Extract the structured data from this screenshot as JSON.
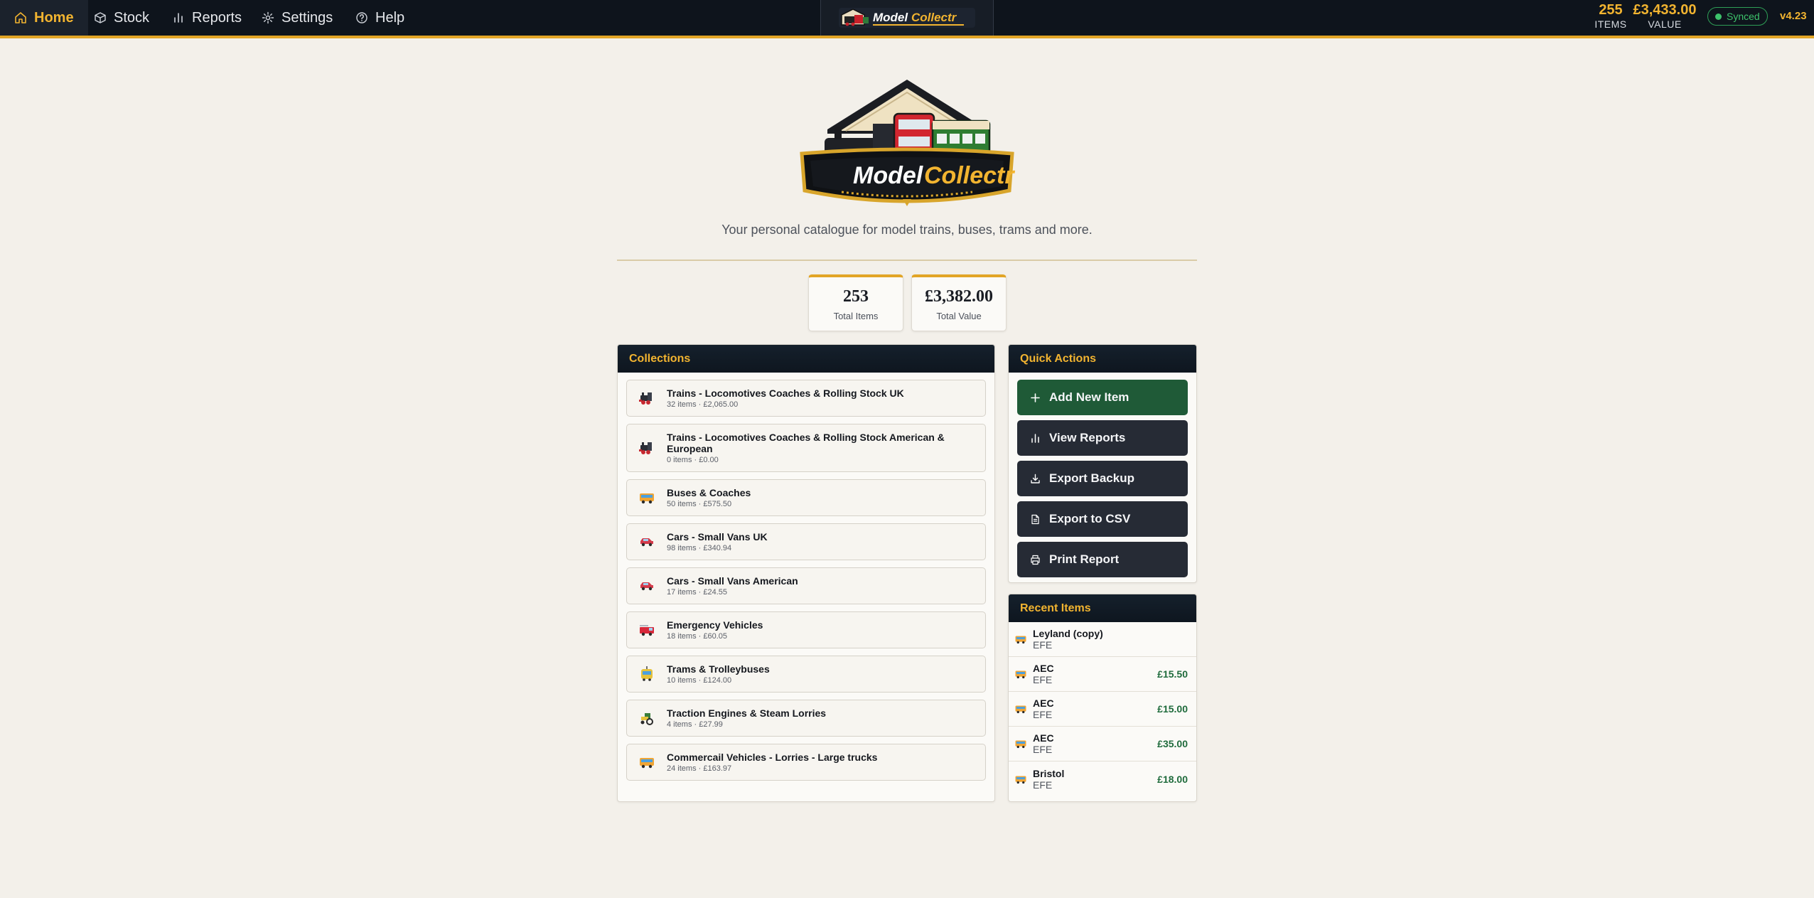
{
  "nav": {
    "tabs": [
      {
        "label": "Home",
        "icon": "home-icon",
        "active": true
      },
      {
        "label": "Stock",
        "icon": "box-icon"
      },
      {
        "label": "Reports",
        "icon": "bar-chart-icon"
      },
      {
        "label": "Settings",
        "icon": "gear-icon"
      },
      {
        "label": "Help",
        "icon": "help-circle-icon"
      }
    ],
    "logo_text": {
      "model": "Model",
      "collectr": "Collectr"
    },
    "items_count": "255",
    "items_label": "ITEMS",
    "value_amount": "£3,433.00",
    "value_label": "VALUE",
    "sync_status": "Synced",
    "version": "v4.23"
  },
  "hero": {
    "logo_text": {
      "model": "Model",
      "collectr": "Collectr"
    },
    "tagline": "Your personal catalogue for model trains, buses, trams and more."
  },
  "stats": [
    {
      "value": "253",
      "label": "Total Items"
    },
    {
      "value": "£3,382.00",
      "label": "Total Value"
    }
  ],
  "collections": {
    "title": "Collections",
    "items": [
      {
        "name": "Trains - Locomotives Coaches & Rolling Stock UK",
        "meta": "32 items · £2,065.00",
        "icon": "locomotive-icon"
      },
      {
        "name": "Trains - Locomotives Coaches & Rolling Stock American & European",
        "meta": "0 items · £0.00",
        "icon": "locomotive-icon"
      },
      {
        "name": "Buses & Coaches",
        "meta": "50 items · £575.50",
        "icon": "bus-icon"
      },
      {
        "name": "Cars - Small Vans UK",
        "meta": "98 items · £340.94",
        "icon": "car-icon"
      },
      {
        "name": "Cars - Small Vans American",
        "meta": "17 items · £24.55",
        "icon": "car-icon"
      },
      {
        "name": "Emergency Vehicles",
        "meta": "18 items · £60.05",
        "icon": "fire-engine-icon"
      },
      {
        "name": "Trams & Trolleybuses",
        "meta": "10 items · £124.00",
        "icon": "tram-icon"
      },
      {
        "name": "Traction Engines & Steam Lorries",
        "meta": "4 items · £27.99",
        "icon": "tractor-icon"
      },
      {
        "name": "Commercail Vehicles - Lorries - Large trucks",
        "meta": "24 items · £163.97",
        "icon": "bus-icon"
      }
    ]
  },
  "quick_actions": {
    "title": "Quick Actions",
    "buttons": [
      {
        "label": "Add New Item",
        "icon": "plus-icon"
      },
      {
        "label": "View Reports",
        "icon": "bar-chart-icon"
      },
      {
        "label": "Export Backup",
        "icon": "download-icon"
      },
      {
        "label": "Export to CSV",
        "icon": "file-icon"
      },
      {
        "label": "Print Report",
        "icon": "printer-icon"
      }
    ]
  },
  "recent": {
    "title": "Recent Items",
    "items": [
      {
        "name": "Leyland (copy)",
        "maker": "EFE",
        "price": ""
      },
      {
        "name": "AEC",
        "maker": "EFE",
        "price": "£15.50"
      },
      {
        "name": "AEC",
        "maker": "EFE",
        "price": "£15.00"
      },
      {
        "name": "AEC",
        "maker": "EFE",
        "price": "£35.00"
      },
      {
        "name": "Bristol",
        "maker": "EFE",
        "price": "£18.00"
      }
    ]
  },
  "colors": {
    "nav_bg": "#0e141c",
    "accent": "#f2b430",
    "primary_button": "#1f5a37",
    "dark_button": "#262b35",
    "price_green": "#1f6b3c",
    "synced_green": "#3dc26b"
  }
}
